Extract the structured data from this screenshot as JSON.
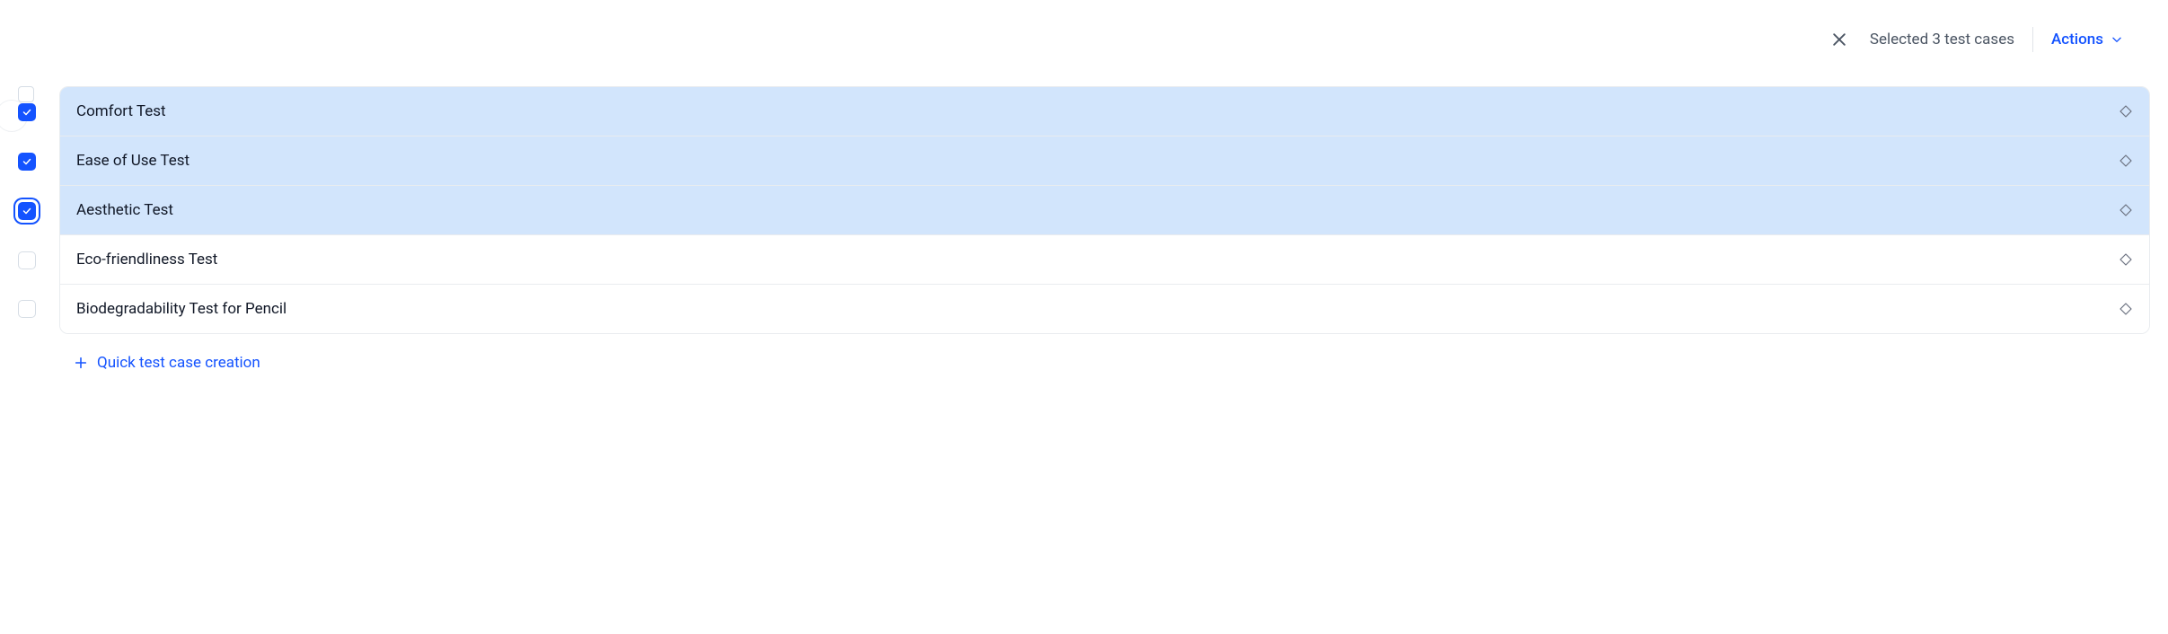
{
  "header": {
    "selectedLabel": "Selected 3 test cases",
    "actionsLabel": "Actions"
  },
  "rows": [
    {
      "title": "Comfort Test",
      "selected": true,
      "focused": false
    },
    {
      "title": "Ease of Use Test",
      "selected": true,
      "focused": false
    },
    {
      "title": "Aesthetic Test",
      "selected": true,
      "focused": true
    },
    {
      "title": "Eco-friendliness Test",
      "selected": false,
      "focused": false
    },
    {
      "title": "Biodegradability Test for Pencil",
      "selected": false,
      "focused": false
    }
  ],
  "quickCreateLabel": "Quick test case creation"
}
